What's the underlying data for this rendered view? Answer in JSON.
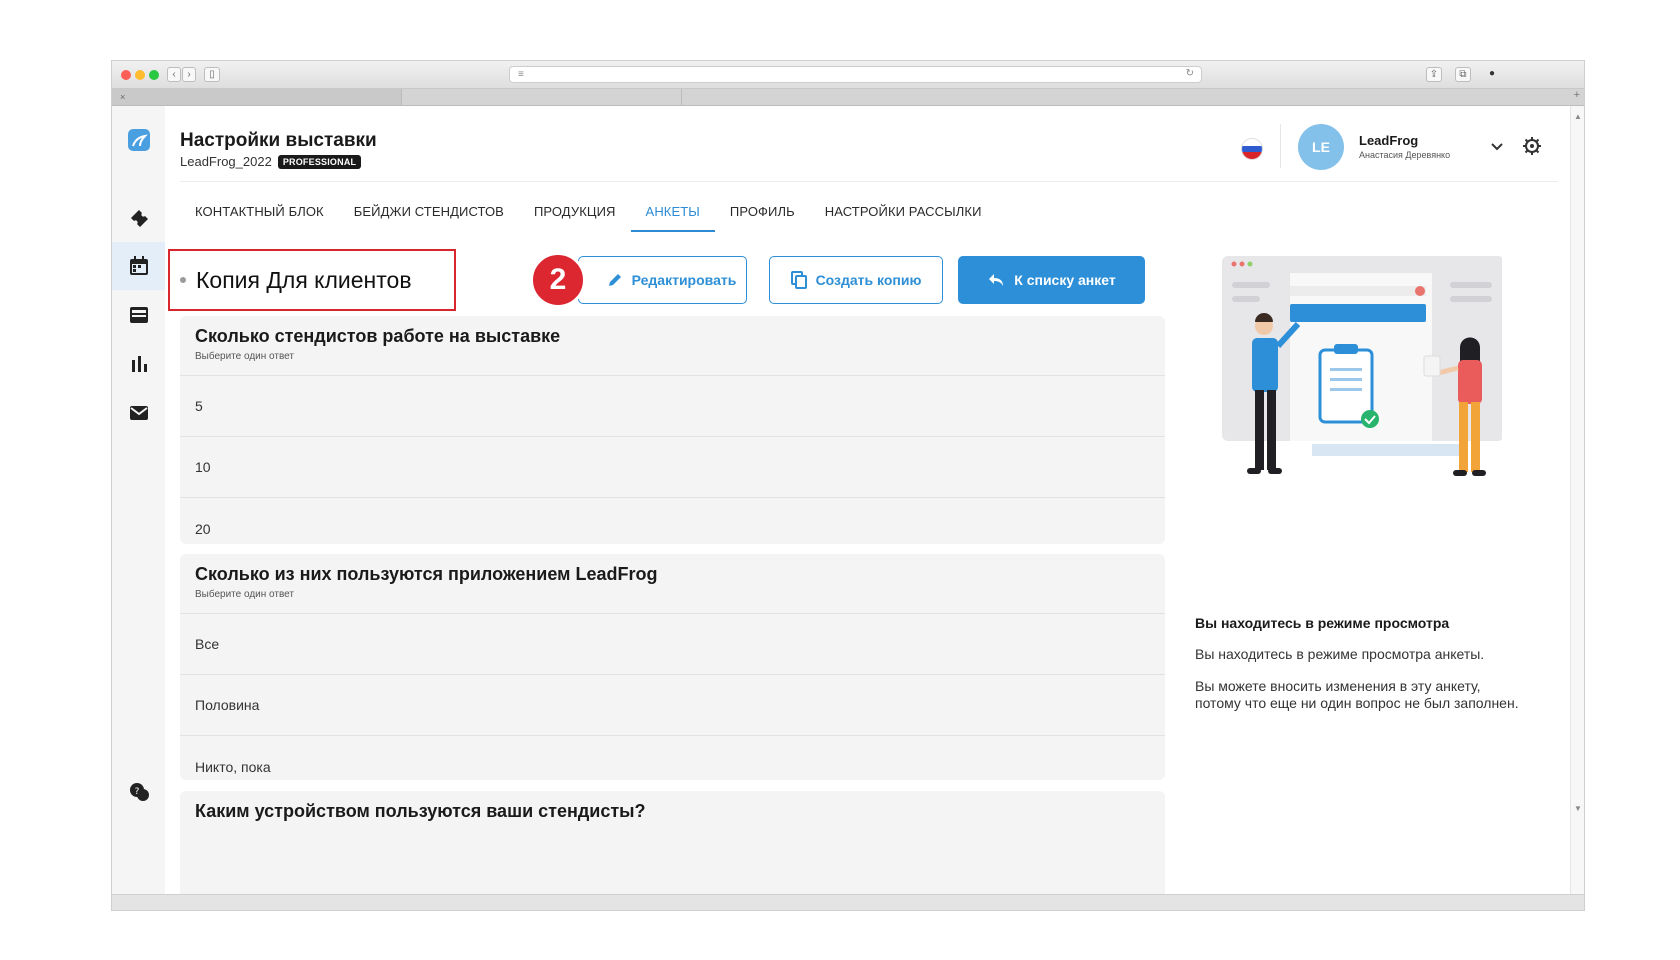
{
  "header": {
    "title": "Настройки выставки",
    "subtitle": "LeadFrog_2022",
    "plan_badge": "PROFESSIONAL"
  },
  "user": {
    "initials": "LE",
    "name": "LeadFrog",
    "person": "Анастасия Деревянко"
  },
  "tabs": [
    {
      "label": "КОНТАКТНЫЙ БЛОК"
    },
    {
      "label": "БЕЙДЖИ СТЕНДИСТОВ"
    },
    {
      "label": "ПРОДУКЦИЯ"
    },
    {
      "label": "АНКЕТЫ",
      "active": true
    },
    {
      "label": "ПРОФИЛЬ"
    },
    {
      "label": "НАСТРОЙКИ РАССЫЛКИ"
    }
  ],
  "survey": {
    "title": "Копия Для клиентов",
    "step_number": "2"
  },
  "actions": {
    "edit": "Редактировать",
    "copy": "Создать копию",
    "back": "К списку анкет"
  },
  "questions": [
    {
      "title": "Сколько стендистов работе на выставке",
      "hint": "Выберите один ответ",
      "options": [
        "5",
        "10",
        "20"
      ]
    },
    {
      "title": "Сколько из них пользуются приложением LeadFrog",
      "hint": "Выберите один ответ",
      "options": [
        "Все",
        "Половина",
        "Никто, пока"
      ]
    },
    {
      "title": "Каким устройством пользуются ваши стендисты?"
    }
  ],
  "info": {
    "title": "Вы находитесь в режиме просмотра",
    "text1": "Вы находитесь в режиме просмотра анкеты.",
    "text2": "Вы можете вносить изменения в эту анкету, потому что еще ни один вопрос не был заполнен."
  },
  "colors": {
    "accent": "#2d8fd8",
    "highlight_red": "#d9252c",
    "avatar": "#83c1ea"
  }
}
